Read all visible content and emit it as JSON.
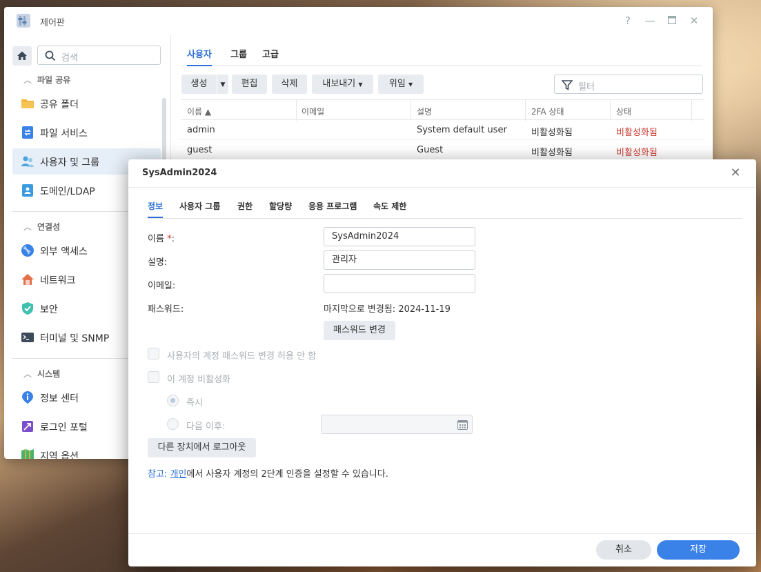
{
  "window": {
    "title": "제어판",
    "help_icon": "question-icon",
    "controls": [
      "?",
      "—",
      "▭",
      "✕"
    ]
  },
  "sidebar": {
    "search_placeholder": "검색",
    "sections": [
      {
        "label": "파일 공유",
        "items": [
          {
            "label": "공유 폴더",
            "icon": "folder-icon",
            "color": "#f2b53b"
          },
          {
            "label": "파일 서비스",
            "icon": "file-services-icon",
            "color": "#3a82e8"
          },
          {
            "label": "사용자 및 그룹",
            "icon": "users-icon",
            "color": "#4aa3df",
            "active": true
          },
          {
            "label": "도메인/LDAP",
            "icon": "directory-icon",
            "color": "#3a9ae0"
          }
        ]
      },
      {
        "label": "연결성",
        "items": [
          {
            "label": "외부 액세스",
            "icon": "external-access-icon",
            "color": "#3a82e8"
          },
          {
            "label": "네트워크",
            "icon": "network-home-icon",
            "color": "#e46f4a"
          },
          {
            "label": "보안",
            "icon": "shield-icon",
            "color": "#3fc0b0"
          },
          {
            "label": "터미널 및 SNMP",
            "icon": "terminal-icon",
            "color": "#3c4a5a"
          }
        ]
      },
      {
        "label": "시스템",
        "items": [
          {
            "label": "정보 센터",
            "icon": "info-icon",
            "color": "#3a82e8"
          },
          {
            "label": "로그인 포털",
            "icon": "login-portal-icon",
            "color": "#7b4fc9"
          },
          {
            "label": "지역 옵션",
            "icon": "region-icon",
            "color": "#4ab56a"
          }
        ]
      }
    ]
  },
  "main": {
    "tabs": [
      {
        "label": "사용자",
        "active": true
      },
      {
        "label": "그룹"
      },
      {
        "label": "고급"
      }
    ],
    "toolbar": {
      "create": "생성",
      "edit": "편집",
      "delete": "삭제",
      "export": "내보내기",
      "delegate": "위임",
      "filter_placeholder": "필터"
    },
    "table": {
      "headers": [
        "이름 ▲",
        "이메일",
        "설명",
        "2FA 상태",
        "상태"
      ],
      "rows": [
        {
          "name": "admin",
          "email": "",
          "desc": "System default user",
          "twofa": "비활성화됨",
          "status": "비활성화됨"
        },
        {
          "name": "guest",
          "email": "",
          "desc": "Guest",
          "twofa": "비활성화됨",
          "status": "비활성화됨"
        }
      ]
    }
  },
  "dialog": {
    "title": "SysAdmin2024",
    "tabs": [
      {
        "label": "정보",
        "active": true
      },
      {
        "label": "사용자 그룹"
      },
      {
        "label": "권한"
      },
      {
        "label": "할당량"
      },
      {
        "label": "응용 프로그램"
      },
      {
        "label": "속도 제한"
      }
    ],
    "fields": {
      "name_label": "이름",
      "name_required": "*",
      "name_colon": ":",
      "name_value": "SysAdmin2024",
      "desc_label": "설명:",
      "desc_value": "관리자",
      "email_label": "이메일:",
      "email_value": "",
      "password_label": "패스워드:",
      "password_changed": "마지막으로 변경됨: 2024-11-19",
      "change_password_button": "패스워드 변경"
    },
    "options": {
      "disallow_pw_change": "사용자의 계정 패스워드 변경 허용 안 함",
      "disable_account": "이 계정 비활성화",
      "immediately": "즉시",
      "after": "다음 이후:"
    },
    "logout_button": "다른 장치에서 로그아웃",
    "note": {
      "prefix": "참고:",
      "link": "개인",
      "suffix": "에서 사용자 계정의 2단계 인증을 설정할 수 있습니다."
    },
    "cancel": "취소",
    "save": "저장"
  }
}
